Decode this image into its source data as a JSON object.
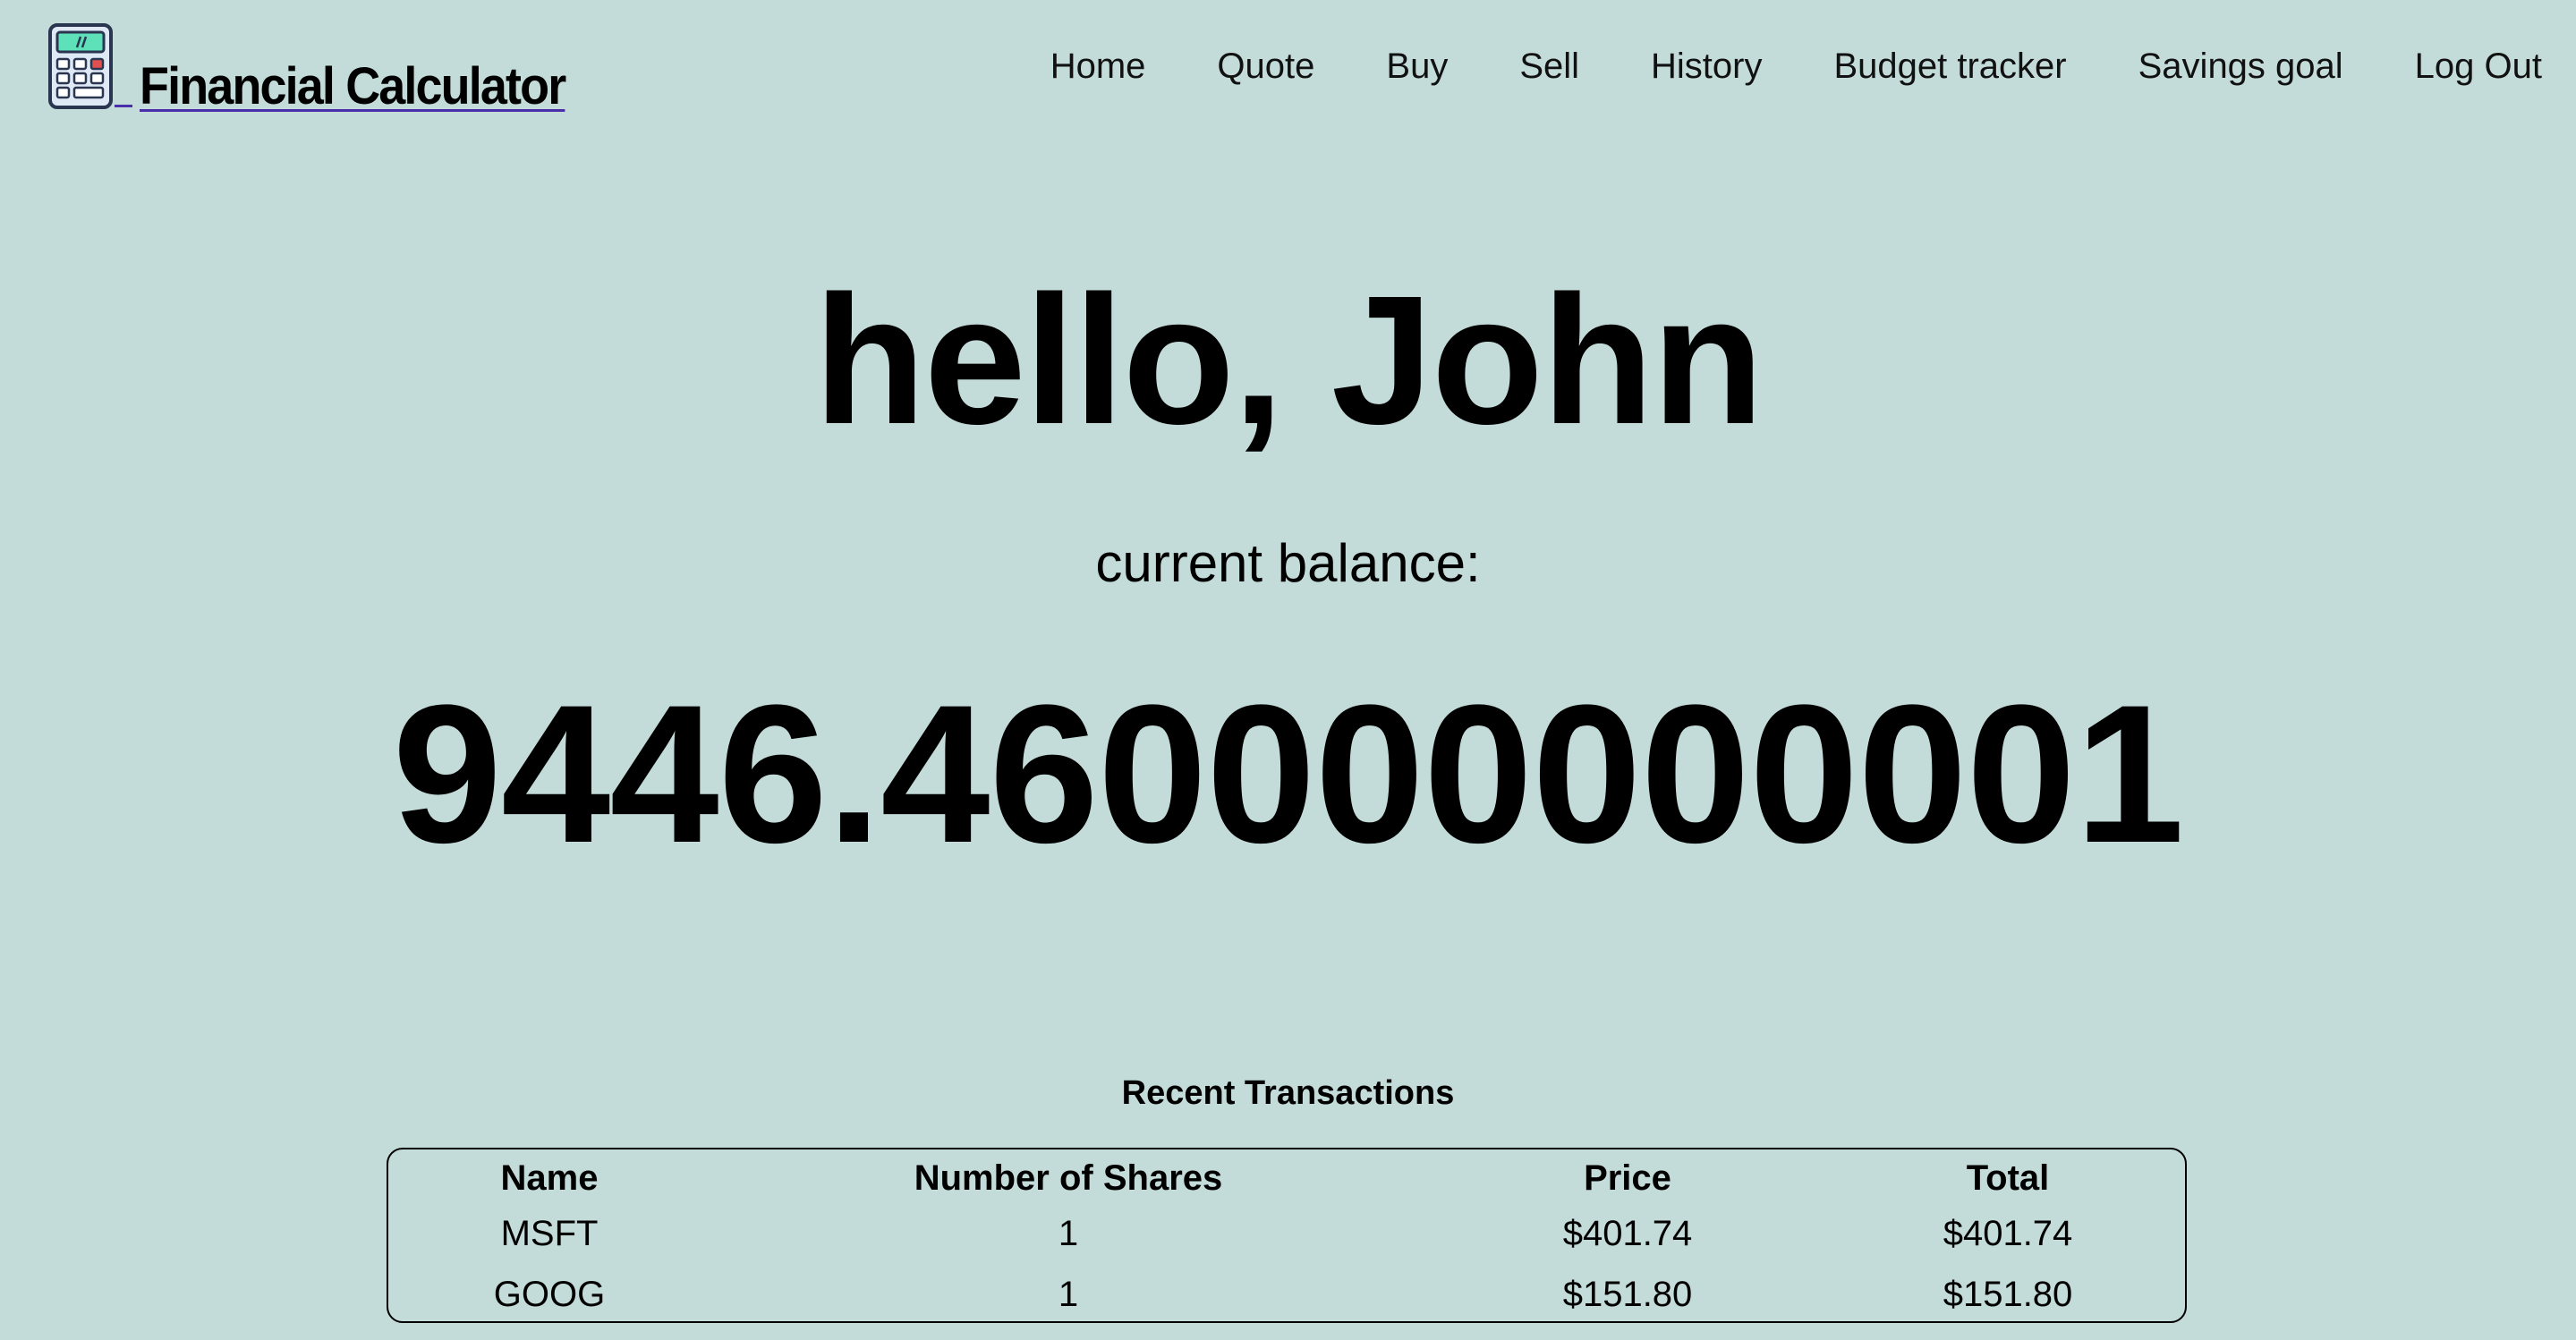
{
  "brand": {
    "title": "Financial Calculator",
    "logo_icon": "calculator-icon"
  },
  "nav": {
    "items": [
      {
        "label": "Home"
      },
      {
        "label": "Quote"
      },
      {
        "label": "Buy"
      },
      {
        "label": "Sell"
      },
      {
        "label": "History"
      },
      {
        "label": "Budget tracker"
      },
      {
        "label": "Savings goal"
      },
      {
        "label": "Log Out"
      }
    ]
  },
  "main": {
    "greeting": "hello, John",
    "balance_label": "current balance:",
    "balance_value": "9446.460000000001"
  },
  "transactions": {
    "title": "Recent Transactions",
    "columns": [
      "Name",
      "Number of Shares",
      "Price",
      "Total"
    ],
    "rows": [
      {
        "name": "MSFT",
        "shares": "1",
        "price": "$401.74",
        "total": "$401.74"
      },
      {
        "name": "GOOG",
        "shares": "1",
        "price": "$151.80",
        "total": "$151.80"
      }
    ]
  },
  "colors": {
    "background": "#c3dcd9",
    "text": "#000000",
    "link_underline": "#4b2fa8",
    "logo_screen": "#5ee0b8",
    "logo_red_key": "#e0504f",
    "logo_body": "#dfe9f5"
  }
}
